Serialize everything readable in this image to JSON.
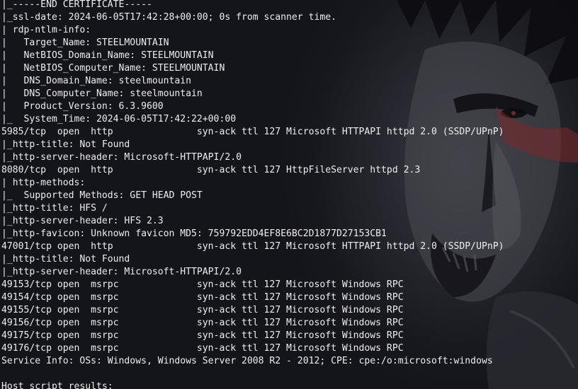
{
  "terminal": {
    "lines": [
      "|_-----END CERTIFICATE-----",
      "|_ssl-date: 2024-06-05T17:42:28+00:00; 0s from scanner time.",
      "| rdp-ntlm-info:",
      "|   Target_Name: STEELMOUNTAIN",
      "|   NetBIOS_Domain_Name: STEELMOUNTAIN",
      "|   NetBIOS_Computer_Name: STEELMOUNTAIN",
      "|   DNS_Domain_Name: steelmountain",
      "|   DNS_Computer_Name: steelmountain",
      "|   Product_Version: 6.3.9600",
      "|_  System_Time: 2024-06-05T17:42:22+00:00",
      "5985/tcp  open  http               syn-ack ttl 127 Microsoft HTTPAPI httpd 2.0 (SSDP/UPnP)",
      "|_http-title: Not Found",
      "|_http-server-header: Microsoft-HTTPAPI/2.0",
      "8080/tcp  open  http               syn-ack ttl 127 HttpFileServer httpd 2.3",
      "| http-methods:",
      "|_  Supported Methods: GET HEAD POST",
      "|_http-title: HFS /",
      "|_http-server-header: HFS 2.3",
      "|_http-favicon: Unknown favicon MD5: 759792EDD4EF8E6BC2D1877D27153CB1",
      "47001/tcp open  http               syn-ack ttl 127 Microsoft HTTPAPI httpd 2.0 (SSDP/UPnP)",
      "|_http-title: Not Found",
      "|_http-server-header: Microsoft-HTTPAPI/2.0",
      "49153/tcp open  msrpc              syn-ack ttl 127 Microsoft Windows RPC",
      "49154/tcp open  msrpc              syn-ack ttl 127 Microsoft Windows RPC",
      "49155/tcp open  msrpc              syn-ack ttl 127 Microsoft Windows RPC",
      "49156/tcp open  msrpc              syn-ack ttl 127 Microsoft Windows RPC",
      "49175/tcp open  msrpc              syn-ack ttl 127 Microsoft Windows RPC",
      "49176/tcp open  msrpc              syn-ack ttl 127 Microsoft Windows RPC",
      "Service Info: OSs: Windows, Windows Server 2008 R2 - 2012; CPE: cpe:/o:microsoft:windows",
      "",
      "Host script results:"
    ]
  },
  "colors": {
    "background": "#14141b",
    "text": "#eeeeee",
    "wallpaper_light": "#4a4a52",
    "wallpaper_dark": "#0c0c11",
    "accent": "#7a2a2a"
  },
  "icons": {
    "wallpaper": "demon-face-wallpaper-icon"
  }
}
